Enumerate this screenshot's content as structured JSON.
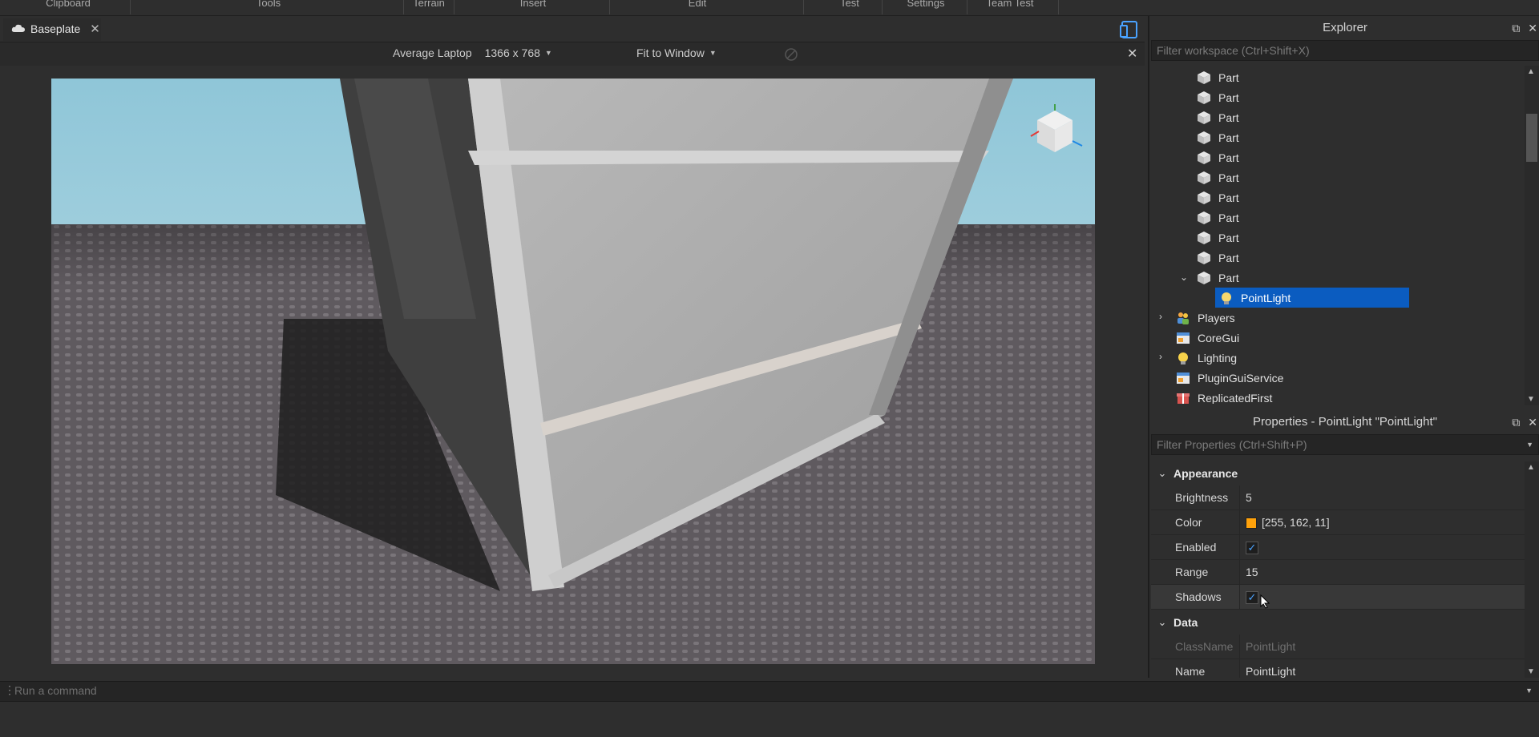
{
  "ribbon": {
    "tabs": [
      "Clipboard",
      "Tools",
      "Terrain",
      "Insert",
      "Edit",
      "Test",
      "Settings",
      "Team Test"
    ]
  },
  "document_tab": {
    "label": "Baseplate"
  },
  "emulation": {
    "device": "Average Laptop",
    "resolution": "1366 x 768",
    "scale": "Fit to Window"
  },
  "explorer": {
    "title": "Explorer",
    "filter_placeholder": "Filter workspace (Ctrl+Shift+X)",
    "items": [
      {
        "label": "Part",
        "icon": "part-icon"
      },
      {
        "label": "Part",
        "icon": "part-icon"
      },
      {
        "label": "Part",
        "icon": "part-icon"
      },
      {
        "label": "Part",
        "icon": "part-icon"
      },
      {
        "label": "Part",
        "icon": "part-icon"
      },
      {
        "label": "Part",
        "icon": "part-icon"
      },
      {
        "label": "Part",
        "icon": "part-icon"
      },
      {
        "label": "Part",
        "icon": "part-icon"
      },
      {
        "label": "Part",
        "icon": "part-icon"
      },
      {
        "label": "Part",
        "icon": "part-icon"
      },
      {
        "label": "Part",
        "icon": "part-icon",
        "expanded": true
      },
      {
        "label": "PointLight",
        "icon": "point-light-icon",
        "selected": true
      },
      {
        "label": "Players",
        "icon": "players-icon"
      },
      {
        "label": "CoreGui",
        "icon": "core-gui-icon",
        "collapsed": true
      },
      {
        "label": "Lighting",
        "icon": "lighting-icon"
      },
      {
        "label": "PluginGuiService",
        "icon": "plugin-gui-icon",
        "collapsed": true
      },
      {
        "label": "ReplicatedFirst",
        "icon": "replicated-first-icon"
      }
    ]
  },
  "properties": {
    "title": "Properties - PointLight \"PointLight\"",
    "filter_placeholder": "Filter Properties (Ctrl+Shift+P)",
    "appearance_label": "Appearance",
    "data_label": "Data",
    "brightness": {
      "name": "Brightness",
      "value": "5"
    },
    "color": {
      "name": "Color",
      "value": "[255, 162, 11]",
      "swatch": "#ffa20b"
    },
    "enabled": {
      "name": "Enabled",
      "checked": true
    },
    "range": {
      "name": "Range",
      "value": "15"
    },
    "shadows": {
      "name": "Shadows",
      "checked": true
    },
    "classname": {
      "name": "ClassName",
      "value": "PointLight"
    },
    "name": {
      "name": "Name",
      "value": "PointLight"
    }
  },
  "command_bar": {
    "placeholder": "Run a command"
  },
  "colors": {
    "selection": "#0b5cc0",
    "panel_bg": "#2e2e2e",
    "check_accent": "#4aa3ff"
  }
}
